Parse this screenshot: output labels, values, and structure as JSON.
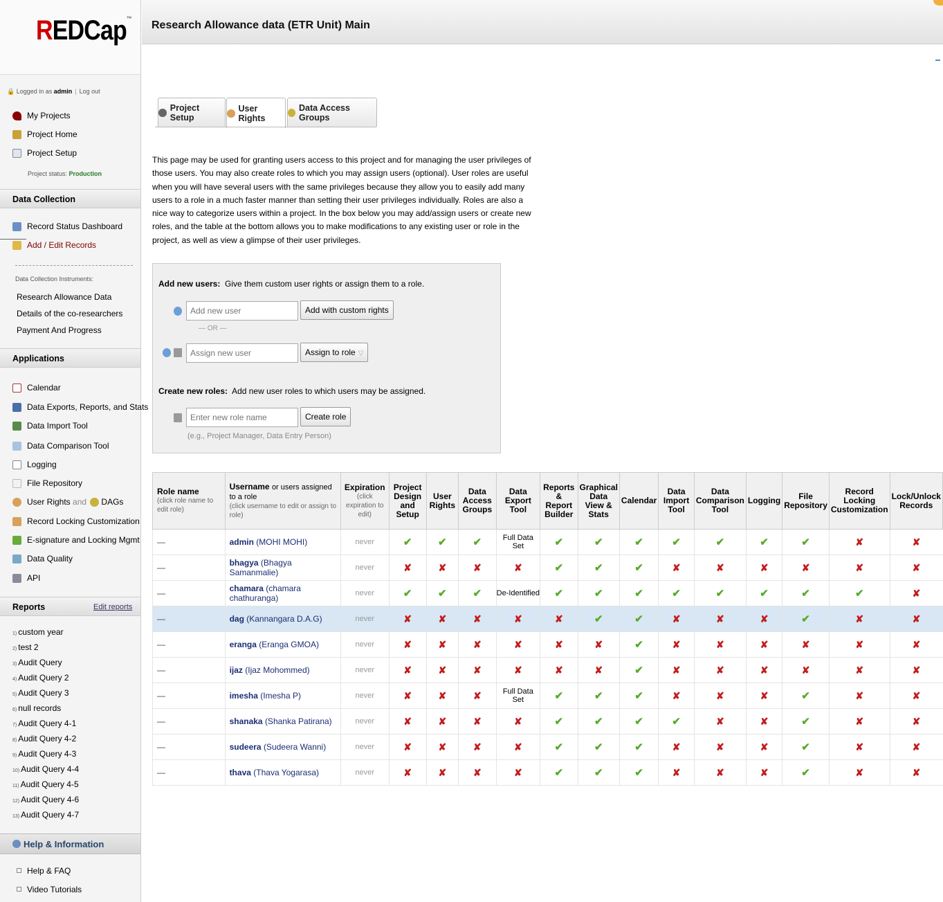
{
  "colors": {
    "check": "#5aaa2a",
    "cross": "#c41c1c",
    "link": "#1c2e73",
    "production": "#2a7a2a"
  },
  "logo": {
    "text_red": "R",
    "text": "EDCap",
    "tm": "™"
  },
  "login": {
    "prefix": "Logged in as",
    "user": "admin",
    "logout": "Log out"
  },
  "sidebar": {
    "nav": {
      "my_projects": "My Projects",
      "project_home": "Project Home",
      "project_setup": "Project Setup"
    },
    "status_label": "Project status:",
    "status_value": "Production",
    "data_collection": {
      "title": "Data Collection",
      "record_status": "Record Status Dashboard",
      "add_edit": "Add / Edit Records",
      "instruments_label": "Data Collection Instruments:",
      "instruments": [
        "Research Allowance Data",
        "Details of the co-researchers",
        "Payment And Progress"
      ]
    },
    "applications": {
      "title": "Applications",
      "items": [
        "Calendar",
        "Data Exports, Reports, and Stats",
        "Data Import Tool",
        "Data Comparison Tool",
        "Logging",
        "File Repository",
        "User Rights",
        "and",
        "DAGs",
        "Record Locking Customization",
        "E-signature and Locking Mgmt",
        "Data Quality",
        "API"
      ]
    },
    "reports": {
      "title": "Reports",
      "edit": "Edit reports",
      "items": [
        {
          "n": "1)",
          "label": "custom year"
        },
        {
          "n": "2)",
          "label": "test 2"
        },
        {
          "n": "3)",
          "label": "Audit Query"
        },
        {
          "n": "4)",
          "label": "Audit Query 2"
        },
        {
          "n": "5)",
          "label": "Audit Query 3"
        },
        {
          "n": "6)",
          "label": "null records"
        },
        {
          "n": "7)",
          "label": "Audit Query 4-1"
        },
        {
          "n": "8)",
          "label": "Audit Query 4-2"
        },
        {
          "n": "9)",
          "label": "Audit Query 4-3"
        },
        {
          "n": "10)",
          "label": "Audit Query 4-4"
        },
        {
          "n": "11)",
          "label": "Audit Query 4-5"
        },
        {
          "n": "12)",
          "label": "Audit Query 4-6"
        },
        {
          "n": "13)",
          "label": "Audit Query 4-7"
        }
      ]
    },
    "help": {
      "title": "Help & Information",
      "items": [
        "Help & FAQ",
        "Video Tutorials"
      ]
    }
  },
  "page_title": "Research Allowance data (ETR Unit) Main",
  "tabs": [
    "Project Setup",
    "User Rights",
    "Data Access Groups"
  ],
  "intro": "This page may be used for granting users access to this project and for managing the user privileges of those users. You may also create roles to which you may assign users (optional). User roles are useful when you will have several users with the same privileges because they allow you to easily add many users to a role in a much faster manner than setting their user privileges individually. Roles are also a nice way to categorize users within a project. In the box below you may add/assign users or create new roles, and the table at the bottom allows you to make modifications to any existing user or role in the project, as well as view a glimpse of their user privileges.",
  "add_users": {
    "label": "Add new users:",
    "desc": "Give them custom user rights or assign them to a role.",
    "add_placeholder": "Add new user",
    "add_button": "Add with custom rights",
    "or": "— OR —",
    "assign_placeholder": "Assign new user",
    "assign_button": "Assign to role"
  },
  "create_roles": {
    "label": "Create new roles:",
    "desc": "Add new user roles to which users may be assigned.",
    "placeholder": "Enter new role name",
    "button": "Create role",
    "example": "(e.g., Project Manager, Data Entry Person)"
  },
  "table": {
    "headers": {
      "role": "Role name",
      "role_sub": "(click role name to edit role)",
      "user_b": "Username",
      "user_rest": "or users assigned to a role",
      "user_sub": "(click username to edit or assign to role)",
      "exp": "Expiration",
      "exp_sub": "(click expiration to edit)",
      "cols": [
        "Project Design and Setup",
        "User Rights",
        "Data Access Groups",
        "Data Export Tool",
        "Reports & Report Builder",
        "Graphical Data View & Stats",
        "Calendar",
        "Data Import Tool",
        "Data Comparison Tool",
        "Logging",
        "File Repository",
        "Record Locking Customization",
        "Lock/Unlock Records"
      ]
    },
    "rows": [
      {
        "role": "—",
        "user": "admin",
        "name": "(MOHI MOHI)",
        "exp": "never",
        "rights": [
          "y",
          "y",
          "y",
          "Full Data Set",
          "y",
          "y",
          "y",
          "y",
          "y",
          "y",
          "y",
          "n",
          "n"
        ]
      },
      {
        "role": "—",
        "user": "bhagya",
        "name": "(Bhagya Samanmalie)",
        "exp": "never",
        "rights": [
          "n",
          "n",
          "n",
          "n",
          "y",
          "y",
          "y",
          "n",
          "n",
          "n",
          "n",
          "n",
          "n"
        ]
      },
      {
        "role": "—",
        "user": "chamara",
        "name": "(chamara chathuranga)",
        "exp": "never",
        "rights": [
          "y",
          "y",
          "y",
          "De-Identified",
          "y",
          "y",
          "y",
          "y",
          "y",
          "y",
          "y",
          "y",
          "n"
        ]
      },
      {
        "role": "—",
        "user": "dag",
        "name": "(Kannangara D.A.G)",
        "exp": "never",
        "rights": [
          "n",
          "n",
          "n",
          "n",
          "n",
          "y",
          "y",
          "n",
          "n",
          "n",
          "y",
          "n",
          "n"
        ]
      },
      {
        "role": "—",
        "user": "eranga",
        "name": "(Eranga GMOA)",
        "exp": "never",
        "rights": [
          "n",
          "n",
          "n",
          "n",
          "n",
          "n",
          "y",
          "n",
          "n",
          "n",
          "n",
          "n",
          "n"
        ]
      },
      {
        "role": "—",
        "user": "ijaz",
        "name": "(Ijaz Mohommed)",
        "exp": "never",
        "rights": [
          "n",
          "n",
          "n",
          "n",
          "n",
          "n",
          "y",
          "n",
          "n",
          "n",
          "n",
          "n",
          "n"
        ]
      },
      {
        "role": "—",
        "user": "imesha",
        "name": "(Imesha P)",
        "exp": "never",
        "rights": [
          "n",
          "n",
          "n",
          "Full Data Set",
          "y",
          "y",
          "y",
          "n",
          "n",
          "n",
          "y",
          "n",
          "n"
        ]
      },
      {
        "role": "—",
        "user": "shanaka",
        "name": "(Shanka Patirana)",
        "exp": "never",
        "rights": [
          "n",
          "n",
          "n",
          "n",
          "y",
          "y",
          "y",
          "y",
          "n",
          "n",
          "y",
          "n",
          "n"
        ]
      },
      {
        "role": "—",
        "user": "sudeera",
        "name": "(Sudeera Wanni)",
        "exp": "never",
        "rights": [
          "n",
          "n",
          "n",
          "n",
          "y",
          "y",
          "y",
          "n",
          "n",
          "n",
          "y",
          "n",
          "n"
        ]
      },
      {
        "role": "—",
        "user": "thava",
        "name": "(Thava Yogarasa)",
        "exp": "never",
        "rights": [
          "n",
          "n",
          "n",
          "n",
          "y",
          "y",
          "y",
          "n",
          "n",
          "n",
          "y",
          "n",
          "n"
        ]
      }
    ]
  }
}
